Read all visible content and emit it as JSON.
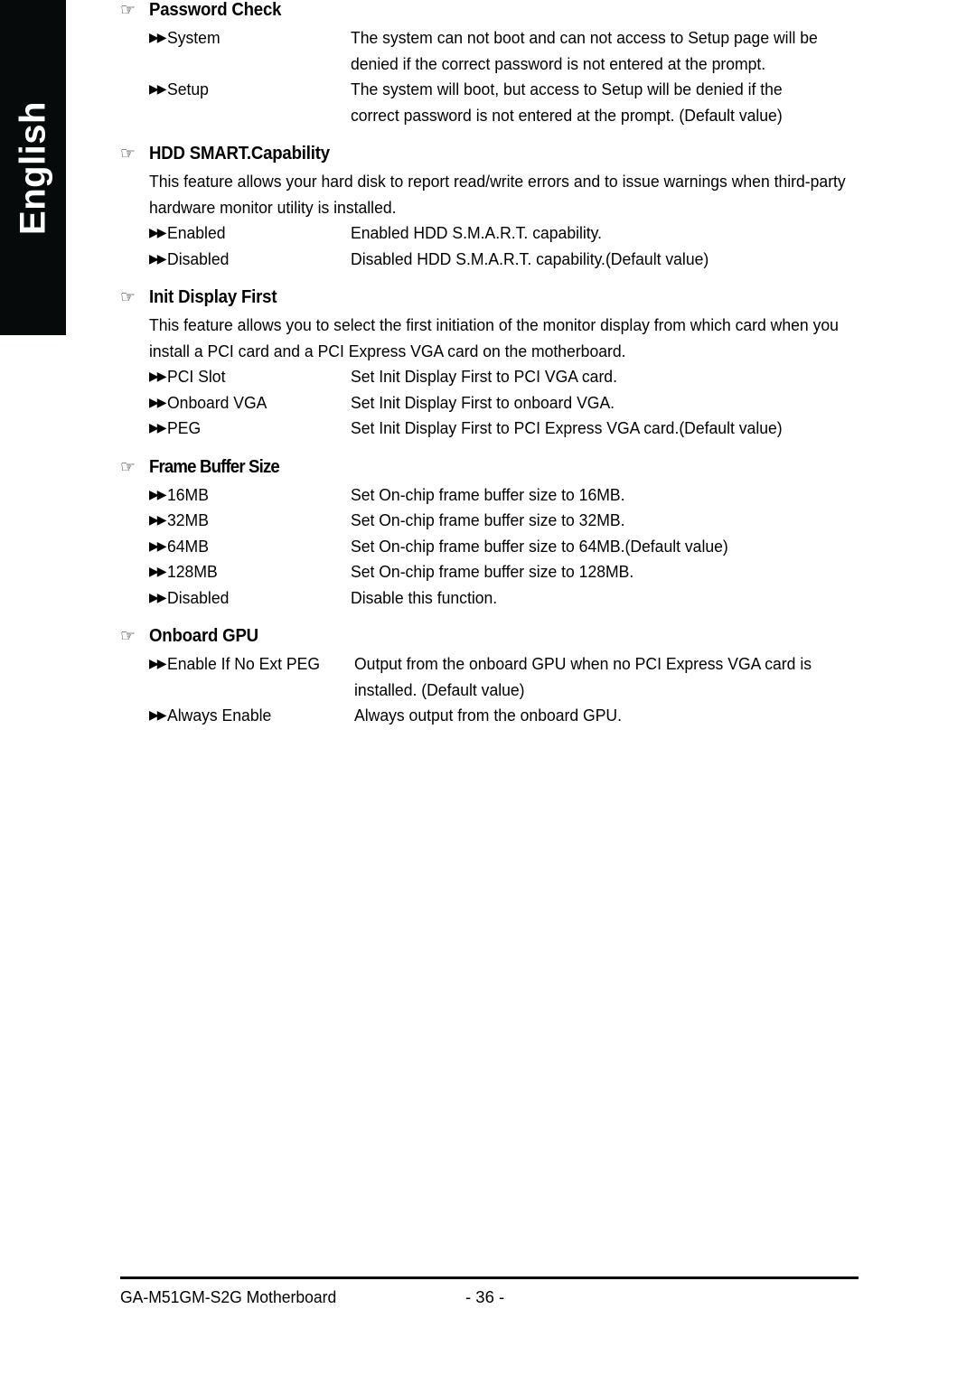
{
  "sidebar": {
    "language_label": "English"
  },
  "icons": {
    "hand": "☞",
    "double_arrow": "▶▶"
  },
  "sections": [
    {
      "title": "Password Check",
      "body": "",
      "options": [
        {
          "label": "System",
          "desc": "The system can not boot and can not access to Setup page will be denied if the correct password is not entered at the prompt."
        },
        {
          "label": "Setup",
          "desc": "The system will boot, but access to Setup will be denied if the correct password is not entered at the prompt. (Default value)"
        }
      ]
    },
    {
      "title": "HDD SMART.Capability",
      "body": "This feature allows your hard disk to report read/write errors and to issue warnings when third-party hardware monitor utility is installed.",
      "options": [
        {
          "label": "Enabled",
          "desc": "Enabled HDD S.M.A.R.T. capability."
        },
        {
          "label": "Disabled",
          "desc": "Disabled HDD S.M.A.R.T. capability.(Default value)"
        }
      ]
    },
    {
      "title": "Init Display First",
      "body": "This feature allows you to select the first initiation of the monitor display from which card when you install a PCI card and a PCI Express VGA card on the motherboard.",
      "options": [
        {
          "label": "PCI Slot",
          "desc": "Set Init Display First to PCI VGA card."
        },
        {
          "label": "Onboard VGA",
          "desc": "Set Init Display First to onboard VGA."
        },
        {
          "label": "PEG",
          "desc": "Set Init Display First to PCI Express VGA card.(Default value)"
        }
      ]
    },
    {
      "title": "Frame Buffer Size",
      "body": "",
      "options": [
        {
          "label": "16MB",
          "desc": "Set On-chip frame buffer size to 16MB."
        },
        {
          "label": "32MB",
          "desc": "Set On-chip frame buffer size to 32MB."
        },
        {
          "label": "64MB",
          "desc": "Set On-chip frame buffer size to 64MB.(Default value)"
        },
        {
          "label": "128MB",
          "desc": "Set On-chip frame buffer size to 128MB."
        },
        {
          "label": "Disabled",
          "desc": "Disable this function."
        }
      ]
    },
    {
      "title": "Onboard GPU",
      "body": "",
      "options": [
        {
          "label": "Enable If No Ext PEG",
          "desc": "Output from the onboard GPU when no PCI Express VGA card is installed. (Default value)"
        },
        {
          "label": "Always Enable",
          "desc": "Always output from the onboard GPU."
        }
      ]
    }
  ],
  "footer": {
    "title": "GA-M51GM-S2G Motherboard",
    "page": "- 36 -"
  }
}
